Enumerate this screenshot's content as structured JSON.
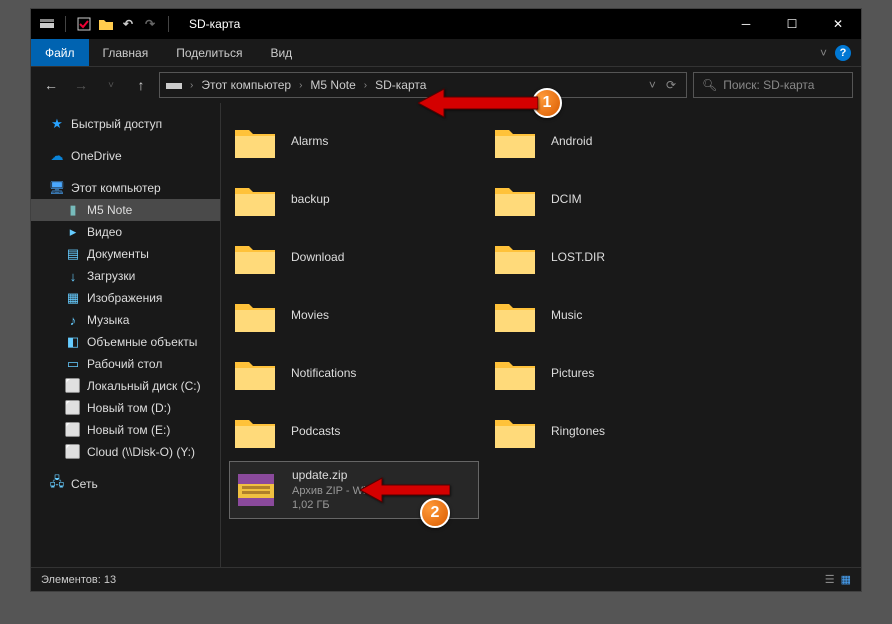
{
  "window_title": "SD-карта",
  "ribbon": {
    "file": "Файл",
    "home": "Главная",
    "share": "Поделиться",
    "view": "Вид"
  },
  "breadcrumbs": [
    "Этот компьютер",
    "M5 Note",
    "SD-карта"
  ],
  "search_placeholder": "Поиск: SD-карта",
  "sidebar": {
    "quick": "Быстрый доступ",
    "onedrive": "OneDrive",
    "thispc": "Этот компьютер",
    "m5note": "M5 Note",
    "video": "Видео",
    "documents": "Документы",
    "downloads": "Загрузки",
    "pictures": "Изображения",
    "music": "Музыка",
    "objects3d": "Объемные объекты",
    "desktop": "Рабочий стол",
    "diskC": "Локальный диск (C:)",
    "diskD": "Новый том (D:)",
    "diskE": "Новый том (E:)",
    "cloud": "Cloud (\\\\Disk-O) (Y:)",
    "network": "Сеть"
  },
  "folders": {
    "r0c0": "Alarms",
    "r0c1": "Android",
    "r1c0": "backup",
    "r1c1": "DCIM",
    "r2c0": "Download",
    "r2c1": "LOST.DIR",
    "r3c0": "Movies",
    "r3c1": "Music",
    "r4c0": "Notifications",
    "r4c1": "Pictures",
    "r5c0": "Podcasts",
    "r5c1": "Ringtones"
  },
  "file": {
    "name": "update.zip",
    "type": "Архив ZIP - WinRAR",
    "size": "1,02 ГБ"
  },
  "status": "Элементов: 13",
  "callouts": {
    "one": "1",
    "two": "2"
  }
}
